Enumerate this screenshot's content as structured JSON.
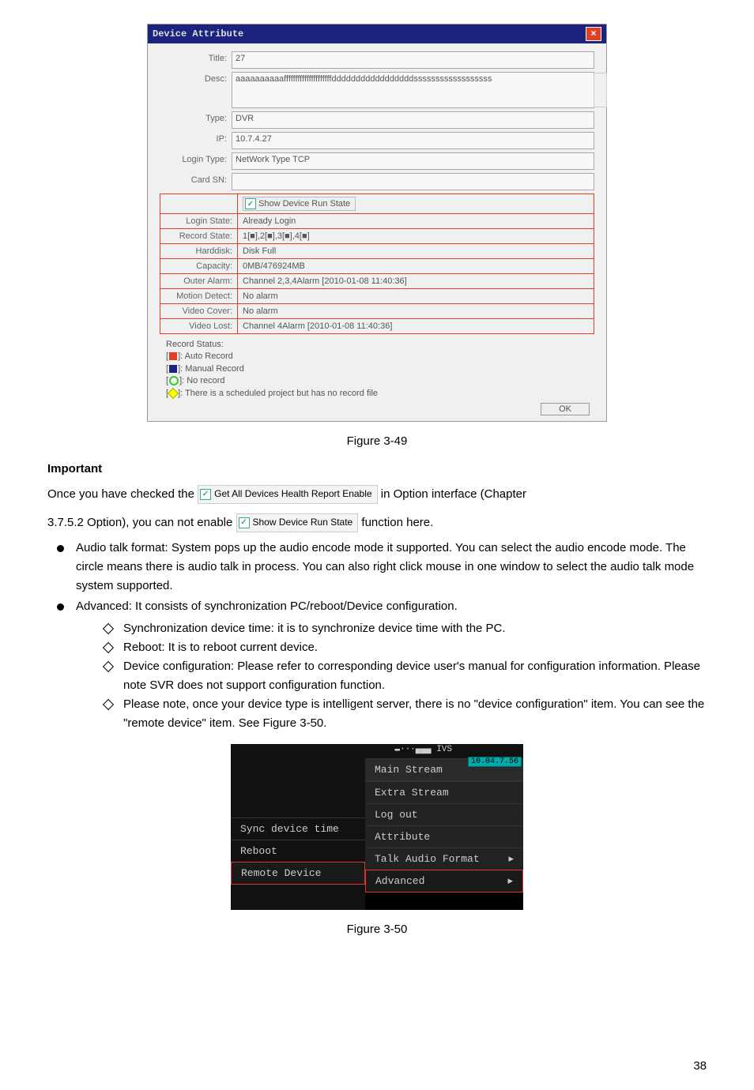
{
  "dialog": {
    "title": "Device Attribute",
    "fields": {
      "title_label": "Title:",
      "title_value": "27",
      "desc_label": "Desc:",
      "desc_value": "aaaaaaaaaafffffffffffffffffffffdddddddddddddddddssssssssssssssssss",
      "type_label": "Type:",
      "type_value": "DVR",
      "ip_label": "IP:",
      "ip_value": "10.7.4.27",
      "login_type_label": "Login Type:",
      "login_type_value": "NetWork Type TCP",
      "card_sn_label": "Card SN:",
      "card_sn_value": ""
    },
    "show_run_state": "Show Device Run State",
    "state": {
      "login_state_label": "Login State:",
      "login_state_value": "Already Login",
      "record_state_label": "Record State:",
      "record_state_value": "1[■],2[■],3[■],4[■]",
      "harddisk_label": "Harddisk:",
      "harddisk_value": "Disk Full",
      "capacity_label": "Capacity:",
      "capacity_value": "0MB/476924MB",
      "outer_alarm_label": "Outer Alarm:",
      "outer_alarm_value": "Channel 2,3,4Alarm [2010-01-08 11:40:36]",
      "motion_label": "Motion Detect:",
      "motion_value": "No alarm",
      "cover_label": "Video Cover:",
      "cover_value": "No alarm",
      "lost_label": "Video Lost:",
      "lost_value": "Channel 4Alarm [2010-01-08 11:40:36]"
    },
    "legend": {
      "title": "Record Status:",
      "l1": "]: Auto Record",
      "l2": "]: Manual Record",
      "l3": "]: No record",
      "l4": "]: There is a scheduled project but has no record file"
    },
    "ok": "OK"
  },
  "fig1": "Figure 3-49",
  "important": "Important",
  "p1a": "Once you have checked the ",
  "chip1": "Get All Devices Health Report Enable",
  "p1b": " in Option interface (Chapter",
  "p2a": "3.7.5.2 Option), you can not enable ",
  "chip2": "Show Device Run State",
  "p2b": " function here.",
  "b1": "Audio talk format: System pops up the audio encode mode it supported. You can select the audio encode mode. The circle means there is audio talk in process. You can also right click mouse in one window to select the audio talk mode system supported.",
  "b2": "Advanced: It consists of synchronization PC/reboot/Device configuration.",
  "d1": "Synchronization device time: it is to synchronize device time with the PC.",
  "d2": "Reboot: It is to reboot current device.",
  "d3": "Device configuration: Please refer to corresponding device user's manual for configuration information. Please note SVR does not support configuration function.",
  "d4": "Please note, once your device type is intelligent server, there is no \"device configuration\" item. You can see the \"remote device\" item. See Figure 3-50.",
  "ctx_menu": {
    "ivs": "IVS",
    "corner": "10.04.7.56",
    "main": "Main Stream",
    "extra": "Extra Stream",
    "logout": "Log out",
    "attr": "Attribute",
    "talk": "Talk Audio Format",
    "adv": "Advanced",
    "sync": "Sync device time",
    "reboot": "Reboot",
    "remote": "Remote Device"
  },
  "fig2": "Figure 3-50",
  "pagenum": "38"
}
